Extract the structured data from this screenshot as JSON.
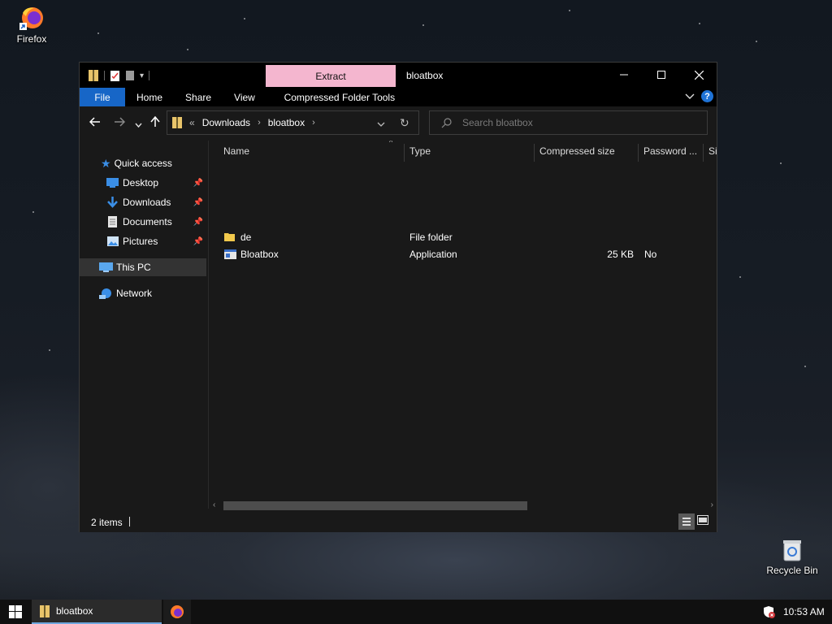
{
  "desktop": {
    "icons": [
      {
        "label": "Firefox",
        "icon": "firefox-icon"
      },
      {
        "label": "Recycle Bin",
        "icon": "recycle-bin-icon"
      }
    ]
  },
  "window": {
    "title": "bloatbox",
    "contextual_tab": "Extract",
    "controls": {
      "minimize": "—",
      "maximize": "☐",
      "close": "✕"
    },
    "ribbon_tabs": {
      "file": "File",
      "home": "Home",
      "share": "Share",
      "view": "View",
      "compressed_tools": "Compressed Folder Tools"
    },
    "colors": {
      "file_tab": "#1766c7",
      "contextual_tab": "#f4b6cf",
      "help": "#1f73d6"
    }
  },
  "navigation": {
    "breadcrumb_prefix": "«",
    "breadcrumb": [
      "Downloads",
      "bloatbox"
    ],
    "search_placeholder": "Search bloatbox"
  },
  "sidebar": {
    "quick_access": "Quick access",
    "pinned": [
      {
        "label": "Desktop",
        "icon": "desktop-icon"
      },
      {
        "label": "Downloads",
        "icon": "downloads-icon"
      },
      {
        "label": "Documents",
        "icon": "documents-icon"
      },
      {
        "label": "Pictures",
        "icon": "pictures-icon"
      }
    ],
    "this_pc": "This PC",
    "network": "Network"
  },
  "columns": {
    "name": "Name",
    "type": "Type",
    "compressed_size": "Compressed size",
    "password": "Password ...",
    "size": "Si"
  },
  "files": [
    {
      "name": "de",
      "type": "File folder",
      "compressed_size": "",
      "password": "",
      "icon": "folder-icon"
    },
    {
      "name": "Bloatbox",
      "type": "Application",
      "compressed_size": "25 KB",
      "password": "No",
      "icon": "application-icon"
    }
  ],
  "status": {
    "items": "2 items"
  },
  "taskbar": {
    "active_app": "bloatbox",
    "time": "10:53 AM"
  }
}
